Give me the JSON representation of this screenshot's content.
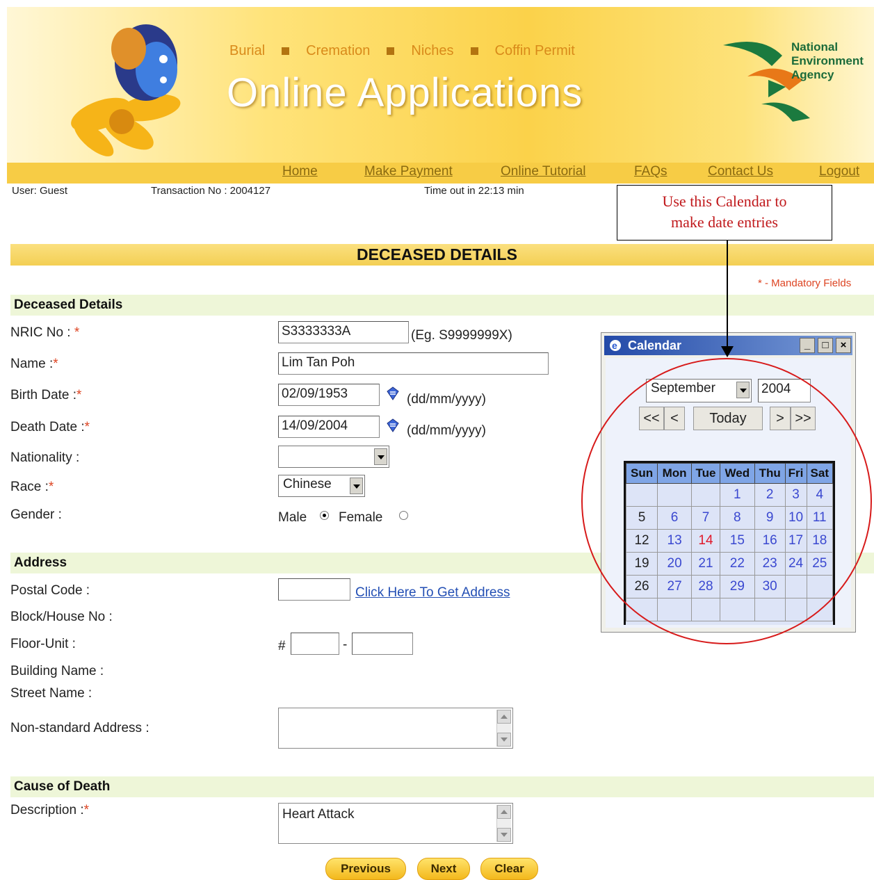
{
  "banner": {
    "links": [
      "Burial",
      "Cremation",
      "Niches",
      "Coffin Permit"
    ],
    "title": "Online Applications",
    "agency": [
      "National",
      "Environment",
      "Agency"
    ]
  },
  "nav": {
    "items": [
      "Home",
      "Make Payment",
      "Online Tutorial",
      "FAQs",
      "Contact Us",
      "Logout"
    ]
  },
  "info": {
    "user": "User: Guest",
    "transaction": "Transaction No : 2004127",
    "timeout": "Time out in 22:13 min"
  },
  "callout": {
    "line1": "Use this Calendar to",
    "line2": "make date entries"
  },
  "page": {
    "title": "DECEASED DETAILS",
    "mandatory": "* - Mandatory Fields"
  },
  "deceased": {
    "heading": "Deceased Details",
    "nric_label": "NRIC No :",
    "nric_value": "S3333333A",
    "nric_hint": "(Eg. S9999999X)",
    "name_label": "Name :",
    "name_value": "Lim Tan Poh",
    "birth_label": "Birth Date :",
    "birth_value": "02/09/1953",
    "date_hint": "(dd/mm/yyyy)",
    "death_label": "Death Date :",
    "death_value": "14/09/2004",
    "nationality_label": "Nationality :",
    "nationality_value": "",
    "race_label": "Race :",
    "race_value": "Chinese",
    "gender_label": "Gender :",
    "gender_male": "Male",
    "gender_female": "Female",
    "star": "*"
  },
  "address": {
    "heading": "Address",
    "postal_label": "Postal Code :",
    "postal_value": "",
    "get_address": "Click Here To Get Address",
    "block_label": "Block/House No :",
    "floor_label": "Floor-Unit :",
    "hash": "#",
    "dash": "-",
    "building_label": "Building Name :",
    "street_label": "Street Name :",
    "nonstd_label": "Non-standard Address :"
  },
  "cause": {
    "heading": "Cause of Death",
    "desc_label": "Description :",
    "desc_value": "Heart Attack"
  },
  "buttons": {
    "previous": "Previous",
    "next": "Next",
    "clear": "Clear"
  },
  "calendar": {
    "title": "Calendar",
    "month": "September",
    "year": "2004",
    "nav_first": "<<",
    "nav_prev": "<",
    "today": "Today",
    "nav_next": ">",
    "nav_last": ">>",
    "days": [
      "Sun",
      "Mon",
      "Tue",
      "Wed",
      "Thu",
      "Fri",
      "Sat"
    ],
    "weeks": [
      [
        "",
        "",
        "",
        "1",
        "2",
        "3",
        "4"
      ],
      [
        "5",
        "6",
        "7",
        "8",
        "9",
        "10",
        "11"
      ],
      [
        "12",
        "13",
        "14",
        "15",
        "16",
        "17",
        "18"
      ],
      [
        "19",
        "20",
        "21",
        "22",
        "23",
        "24",
        "25"
      ],
      [
        "26",
        "27",
        "28",
        "29",
        "30",
        "",
        ""
      ],
      [
        "",
        "",
        "",
        "",
        "",
        "",
        ""
      ]
    ],
    "highlight": "14"
  },
  "colors": {
    "accent": "#f7cc45",
    "link": "#234fb4",
    "mandatory": "#dd4422",
    "callout_text": "#c0181b"
  }
}
